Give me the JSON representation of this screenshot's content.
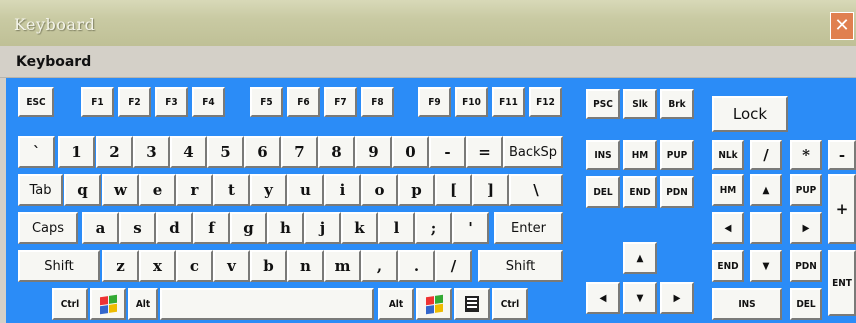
{
  "window": {
    "title": "Keyboard",
    "close_glyph": "✕"
  },
  "menu": {
    "keyboard": "Keyboard"
  },
  "keys": [
    {
      "id": "esc",
      "label": "ESC",
      "cls": "small"
    },
    {
      "id": "f1",
      "label": "F1",
      "cls": "small"
    },
    {
      "id": "f2",
      "label": "F2",
      "cls": "small"
    },
    {
      "id": "f3",
      "label": "F3",
      "cls": "small"
    },
    {
      "id": "f4",
      "label": "F4",
      "cls": "small"
    },
    {
      "id": "f5",
      "label": "F5",
      "cls": "small"
    },
    {
      "id": "f6",
      "label": "F6",
      "cls": "small"
    },
    {
      "id": "f7",
      "label": "F7",
      "cls": "small"
    },
    {
      "id": "f8",
      "label": "F8",
      "cls": "small"
    },
    {
      "id": "f9",
      "label": "F9",
      "cls": "small"
    },
    {
      "id": "f10",
      "label": "F10",
      "cls": "small"
    },
    {
      "id": "f11",
      "label": "F11",
      "cls": "small"
    },
    {
      "id": "f12",
      "label": "F12",
      "cls": "small"
    },
    {
      "id": "psc",
      "label": "PSC",
      "cls": "small"
    },
    {
      "id": "slk",
      "label": "Slk",
      "cls": "small"
    },
    {
      "id": "brk",
      "label": "Brk",
      "cls": "small"
    },
    {
      "id": "lock",
      "label": "Lock",
      "cls": "lock"
    },
    {
      "id": "backtick",
      "label": "`",
      "cls": "big"
    },
    {
      "id": "n1",
      "label": "1",
      "cls": "big"
    },
    {
      "id": "n2",
      "label": "2",
      "cls": "big"
    },
    {
      "id": "n3",
      "label": "3",
      "cls": "big"
    },
    {
      "id": "n4",
      "label": "4",
      "cls": "big"
    },
    {
      "id": "n5",
      "label": "5",
      "cls": "big"
    },
    {
      "id": "n6",
      "label": "6",
      "cls": "big"
    },
    {
      "id": "n7",
      "label": "7",
      "cls": "big"
    },
    {
      "id": "n8",
      "label": "8",
      "cls": "big"
    },
    {
      "id": "n9",
      "label": "9",
      "cls": "big"
    },
    {
      "id": "n0",
      "label": "0",
      "cls": "big"
    },
    {
      "id": "minus",
      "label": "-",
      "cls": "big"
    },
    {
      "id": "equals",
      "label": "=",
      "cls": "big"
    },
    {
      "id": "backsp",
      "label": "BackSp",
      "cls": "med"
    },
    {
      "id": "ins",
      "label": "INS",
      "cls": "small"
    },
    {
      "id": "hm",
      "label": "HM",
      "cls": "small"
    },
    {
      "id": "pup",
      "label": "PUP",
      "cls": "small"
    },
    {
      "id": "nlk",
      "label": "NLk",
      "cls": "small"
    },
    {
      "id": "np-slash",
      "label": "/",
      "cls": "big"
    },
    {
      "id": "np-star",
      "label": "*",
      "cls": "big"
    },
    {
      "id": "np-minus",
      "label": "-",
      "cls": "big"
    },
    {
      "id": "tab",
      "label": "Tab",
      "cls": "med"
    },
    {
      "id": "q",
      "label": "q",
      "cls": "big"
    },
    {
      "id": "w",
      "label": "w",
      "cls": "big"
    },
    {
      "id": "e",
      "label": "e",
      "cls": "big"
    },
    {
      "id": "r",
      "label": "r",
      "cls": "big"
    },
    {
      "id": "t",
      "label": "t",
      "cls": "big"
    },
    {
      "id": "y",
      "label": "y",
      "cls": "big"
    },
    {
      "id": "u",
      "label": "u",
      "cls": "big"
    },
    {
      "id": "i",
      "label": "i",
      "cls": "big"
    },
    {
      "id": "o",
      "label": "o",
      "cls": "big"
    },
    {
      "id": "p",
      "label": "p",
      "cls": "big"
    },
    {
      "id": "lbracket",
      "label": "[",
      "cls": "big"
    },
    {
      "id": "rbracket",
      "label": "]",
      "cls": "big"
    },
    {
      "id": "backslash",
      "label": "\\",
      "cls": "big"
    },
    {
      "id": "del",
      "label": "DEL",
      "cls": "small"
    },
    {
      "id": "end",
      "label": "END",
      "cls": "small"
    },
    {
      "id": "pdn",
      "label": "PDN",
      "cls": "small"
    },
    {
      "id": "np-hm",
      "label": "HM",
      "cls": "small"
    },
    {
      "id": "np-up",
      "label": "▲",
      "cls": "small"
    },
    {
      "id": "np-pup",
      "label": "PUP",
      "cls": "small"
    },
    {
      "id": "np-plus",
      "label": "+",
      "cls": "big"
    },
    {
      "id": "caps",
      "label": "Caps",
      "cls": "med"
    },
    {
      "id": "a",
      "label": "a",
      "cls": "big"
    },
    {
      "id": "s",
      "label": "s",
      "cls": "big"
    },
    {
      "id": "d",
      "label": "d",
      "cls": "big"
    },
    {
      "id": "f",
      "label": "f",
      "cls": "big"
    },
    {
      "id": "g",
      "label": "g",
      "cls": "big"
    },
    {
      "id": "h",
      "label": "h",
      "cls": "big"
    },
    {
      "id": "j",
      "label": "j",
      "cls": "big"
    },
    {
      "id": "k",
      "label": "k",
      "cls": "big"
    },
    {
      "id": "l",
      "label": "l",
      "cls": "big"
    },
    {
      "id": "semicolon",
      "label": ";",
      "cls": "big"
    },
    {
      "id": "quote",
      "label": "'",
      "cls": "big"
    },
    {
      "id": "enter",
      "label": "Enter",
      "cls": "med"
    },
    {
      "id": "np-left",
      "label": "◀",
      "cls": "small"
    },
    {
      "id": "np-5",
      "label": "",
      "cls": "small"
    },
    {
      "id": "np-right",
      "label": "▶",
      "cls": "small"
    },
    {
      "id": "lshift",
      "label": "Shift",
      "cls": "med"
    },
    {
      "id": "z",
      "label": "z",
      "cls": "big"
    },
    {
      "id": "x",
      "label": "x",
      "cls": "big"
    },
    {
      "id": "c",
      "label": "c",
      "cls": "big"
    },
    {
      "id": "v",
      "label": "v",
      "cls": "big"
    },
    {
      "id": "b",
      "label": "b",
      "cls": "big"
    },
    {
      "id": "n",
      "label": "n",
      "cls": "big"
    },
    {
      "id": "m",
      "label": "m",
      "cls": "big"
    },
    {
      "id": "comma",
      "label": ",",
      "cls": "big"
    },
    {
      "id": "period",
      "label": ".",
      "cls": "big"
    },
    {
      "id": "slash",
      "label": "/",
      "cls": "big"
    },
    {
      "id": "rshift",
      "label": "Shift",
      "cls": "med"
    },
    {
      "id": "up",
      "label": "▲",
      "cls": "small"
    },
    {
      "id": "np-end",
      "label": "END",
      "cls": "small"
    },
    {
      "id": "np-down",
      "label": "▼",
      "cls": "small"
    },
    {
      "id": "np-pdn",
      "label": "PDN",
      "cls": "small"
    },
    {
      "id": "np-ent",
      "label": "ENT",
      "cls": "small"
    },
    {
      "id": "lctrl",
      "label": "Ctrl",
      "cls": "small"
    },
    {
      "id": "lwin",
      "label": "",
      "cls": "win"
    },
    {
      "id": "lalt",
      "label": "Alt",
      "cls": "small"
    },
    {
      "id": "space",
      "label": "",
      "cls": "small"
    },
    {
      "id": "ralt",
      "label": "Alt",
      "cls": "small"
    },
    {
      "id": "rwin",
      "label": "",
      "cls": "win"
    },
    {
      "id": "menukey",
      "label": "",
      "cls": "menu"
    },
    {
      "id": "rctrl",
      "label": "Ctrl",
      "cls": "small"
    },
    {
      "id": "left",
      "label": "◀",
      "cls": "small"
    },
    {
      "id": "down",
      "label": "▼",
      "cls": "small"
    },
    {
      "id": "right",
      "label": "▶",
      "cls": "small"
    },
    {
      "id": "np-ins",
      "label": "INS",
      "cls": "small"
    },
    {
      "id": "np-del",
      "label": "DEL",
      "cls": "small"
    }
  ]
}
